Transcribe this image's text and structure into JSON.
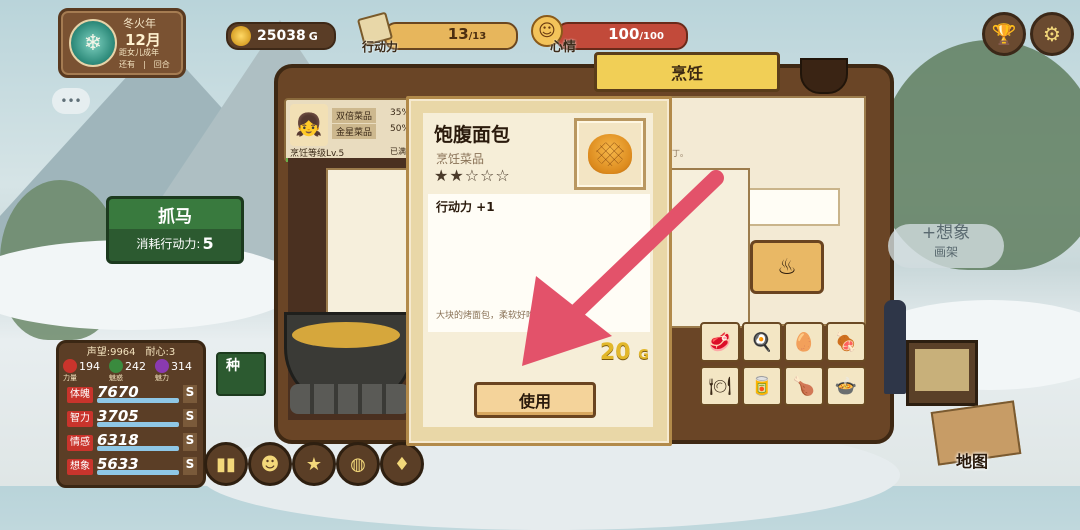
{
  "season": {
    "year_label": "冬火年",
    "month": "12月",
    "line1": "距女儿成年",
    "line2": "还有　|　回合",
    "emblem_icon": "snowflake-emblem-icon"
  },
  "resources": {
    "gold": "25038",
    "gold_unit": "G",
    "action_label": "行动力",
    "action_value": "13",
    "action_max": "/13",
    "mood_label": "心情",
    "mood_value": "100",
    "mood_max": "/100"
  },
  "top_right": {
    "trophy_icon": "trophy-icon",
    "settings_icon": "gear-icon"
  },
  "cook": {
    "tab_title": "烹饪",
    "chef_level": "烹饪等级Lv.5",
    "rows": [
      "双倍菜品",
      "金星菜品"
    ],
    "row_pct": [
      "35%",
      "50%"
    ],
    "done_label": "已满",
    "hint": "丁。"
  },
  "zhuama": {
    "title": "抓马",
    "cost_label": "消耗行动力:",
    "cost_value": "5"
  },
  "left_partial": "种",
  "stats": {
    "header": "声望:9964　耐心:3",
    "minis": [
      {
        "label": "力量",
        "value": "194",
        "color": "#c9342c"
      },
      {
        "label": "魅惑",
        "value": "242",
        "color": "#3a8a3e"
      },
      {
        "label": "魅力",
        "value": "314",
        "color": "#8a3ab0"
      }
    ],
    "rows": [
      {
        "label": "体魄",
        "value": "7670",
        "rank": "S"
      },
      {
        "label": "智力",
        "value": "3705",
        "rank": "S"
      },
      {
        "label": "情感",
        "value": "6318",
        "rank": "S"
      },
      {
        "label": "想象",
        "value": "5633",
        "rank": "S"
      }
    ]
  },
  "popup": {
    "name": "饱腹面包",
    "type": "烹饪菜品",
    "stars": "★★☆☆☆",
    "star_rating": 2,
    "star_max": 5,
    "effect": "行动力 +1",
    "desc": "大块的烤面包，柔软好吃。",
    "price": "20",
    "price_unit": "G",
    "use_label": "使用",
    "image_icon": "bread-icon"
  },
  "imagine": {
    "title": "+想象",
    "sub": "画架"
  },
  "map_label": "地图",
  "dock_icons": [
    "chart-icon",
    "character-icon",
    "star-icon",
    "bag-icon",
    "card-icon"
  ],
  "ingredient_icons": [
    "meat-icon",
    "egg-icon",
    "egg-icon",
    "steak-icon",
    "dish-icon",
    "drink-icon",
    "meat-icon",
    "bowl-icon"
  ],
  "accent": {
    "gold_bar": "#e7b65c",
    "mood_bar": "#c24a3a",
    "arrow": "#e3526a"
  }
}
